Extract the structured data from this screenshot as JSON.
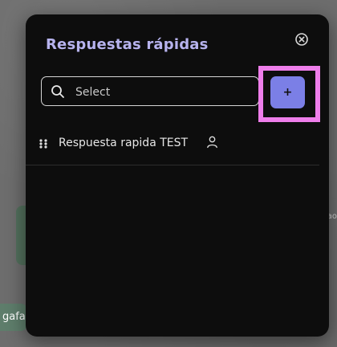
{
  "background": {
    "left_snippet": "gafa",
    "right_snippet": "ao"
  },
  "modal": {
    "title": "Respuestas rápidas",
    "close_icon": "close-circle-icon",
    "search": {
      "placeholder": "Select",
      "value": "",
      "icon": "search-icon"
    },
    "add_button": {
      "label": "+",
      "color": "#7b7fe6",
      "highlight_color": "#ee7eea"
    },
    "items": [
      {
        "label": "Respuesta rapida TEST",
        "handle_icon": "drag-handle-icon",
        "owner_icon": "user-icon"
      }
    ]
  },
  "colors": {
    "modal_bg": "#0d0d0d",
    "title": "#b7b3ee",
    "text": "#e6e6e6",
    "border": "#d5d5d5"
  }
}
